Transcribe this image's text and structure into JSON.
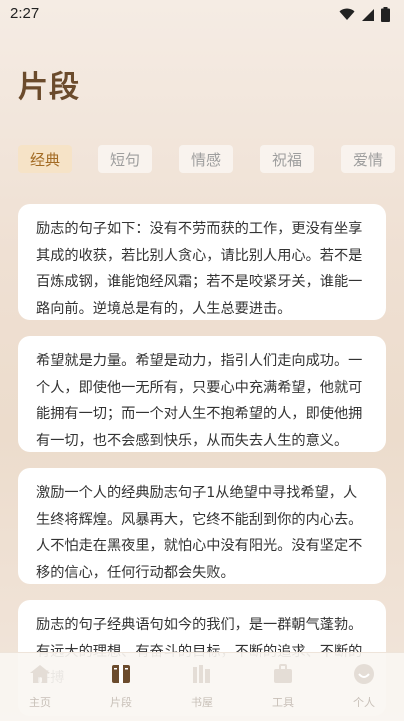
{
  "status": {
    "time": "2:27"
  },
  "page_title": "片段",
  "tabs": [
    "经典",
    "短句",
    "情感",
    "祝福",
    "爱情"
  ],
  "cards": [
    "励志的句子如下：没有不劳而获的工作，更没有坐享其成的收获，若比别人贪心，请比别人用心。若不是百炼成钢，谁能饱经风霜；若不是咬紧牙关，谁能一路向前。逆境总是有的，人生总要进击。",
    "希望就是力量。希望是动力，指引人们走向成功。一个人，即使他一无所有，只要心中充满希望，他就可能拥有一切；而一个对人生不抱希望的人，即使他拥有一切，也不会感到快乐，从而失去人生的意义。",
    "激励一个人的经典励志句子1从绝望中寻找希望，人生终将辉煌。风暴再大，它终不能刮到你的内心去。人不怕走在黑夜里，就怕心中没有阳光。没有坚定不移的信心，任何行动都会失败。",
    "励志的句子经典语句如今的我们，是一群朝气蓬勃。有远大的理想、有奋斗的目标，不断的追求、不断的拼搏"
  ],
  "nav": [
    "主页",
    "片段",
    "书屋",
    "工具",
    "个人"
  ],
  "colors": {
    "accent": "#6b4b2c",
    "tab_active_bg": "#f6e3c7",
    "tab_active_text": "#a36b24"
  }
}
